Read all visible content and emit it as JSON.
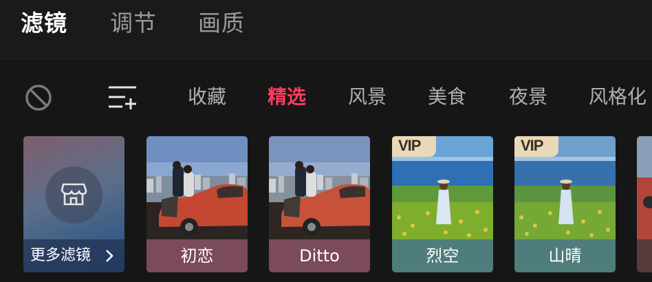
{
  "top_tabs": [
    "滤镜",
    "调节",
    "画质"
  ],
  "active_top_tab": "滤镜",
  "categories": [
    "收藏",
    "精选",
    "风景",
    "美食",
    "夜景",
    "风格化"
  ],
  "active_category": "精选",
  "icons": {
    "none": "no-filter-icon",
    "manage": "manage-list-icon",
    "store": "store-icon",
    "chevron": "chevron-right-icon"
  },
  "more_filters": {
    "label": "更多滤镜"
  },
  "filters": [
    {
      "label": "初恋",
      "vip": false,
      "label_color": "#7b4a5b"
    },
    {
      "label": "Ditto",
      "vip": false,
      "label_color": "#7b4a5b"
    },
    {
      "label": "烈空",
      "vip": true,
      "badge": "VIP",
      "label_color": "#4f7d7b"
    },
    {
      "label": "山晴",
      "vip": true,
      "badge": "VIP",
      "label_color": "#4f7d7b"
    }
  ],
  "colors": {
    "accent": "#ff3b5f",
    "background": "#161616"
  }
}
